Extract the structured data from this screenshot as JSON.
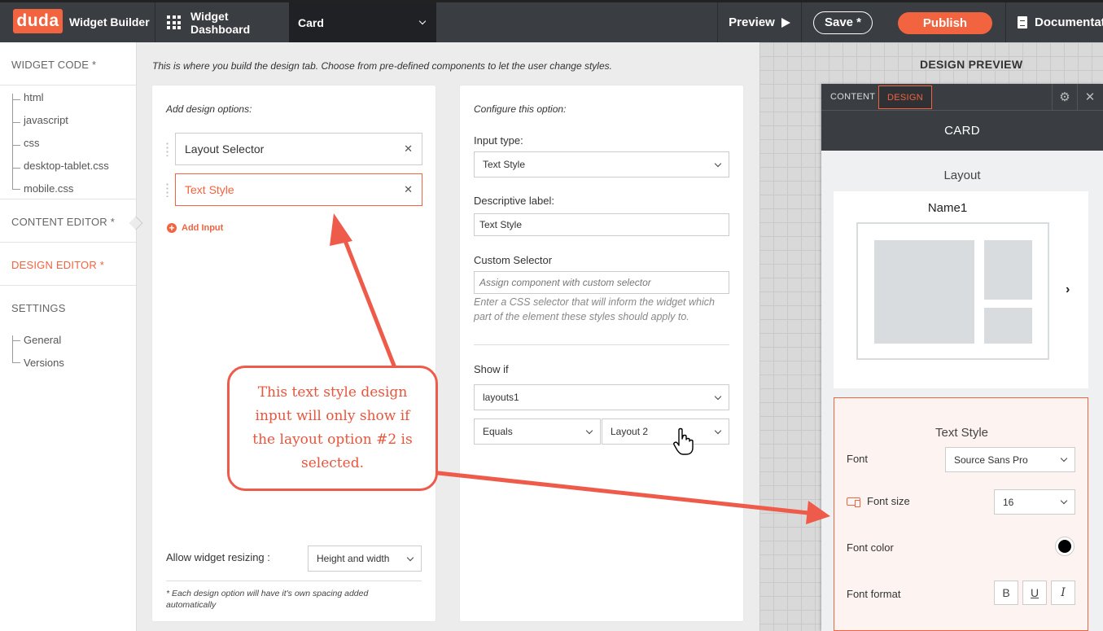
{
  "topbar": {
    "logo": "duda",
    "brand": "Widget Builder",
    "dashboard": "Widget Dashboard",
    "current_widget": "Card",
    "preview": "Preview",
    "save": "Save *",
    "publish": "Publish",
    "docs": "Documentation"
  },
  "sidebar": {
    "widget_code": "WIDGET CODE *",
    "code_files": [
      "html",
      "javascript",
      "css",
      "desktop-tablet.css",
      "mobile.css"
    ],
    "content_editor": "CONTENT EDITOR *",
    "design_editor": "DESIGN EDITOR *",
    "settings": "SETTINGS",
    "settings_items": [
      "General",
      "Versions"
    ]
  },
  "main": {
    "intro": "This is where you build the design tab. Choose from pre-defined components to let the user change styles.",
    "add_panel": {
      "title": "Add design options:",
      "options": [
        "Layout Selector",
        "Text Style"
      ],
      "add_input": "Add Input",
      "resize_label": "Allow widget resizing :",
      "resize_value": "Height and width",
      "footnote": "* Each design option will have it's own spacing added automatically"
    },
    "config_panel": {
      "title": "Configure this option:",
      "input_type_label": "Input type:",
      "input_type_value": "Text Style",
      "desc_label": "Descriptive label:",
      "desc_value": "Text Style",
      "selector_label": "Custom Selector",
      "selector_placeholder": "Assign component with custom selector",
      "selector_help": "Enter a CSS selector that will inform the widget which part of the element these styles should apply to.",
      "show_if_label": "Show if",
      "show_if_field": "layouts1",
      "show_if_operator": "Equals",
      "show_if_value": "Layout 2"
    }
  },
  "callout": "This text style design input will only show if the layout option #2 is selected.",
  "design_preview": {
    "title": "DESIGN PREVIEW",
    "tabs": [
      "CONTENT",
      "DESIGN"
    ],
    "header": "CARD",
    "layout_section": "Layout",
    "layout_name": "Name1",
    "text_style": {
      "title": "Text Style",
      "font_label": "Font",
      "font_value": "Source Sans Pro",
      "size_label": "Font size",
      "size_value": "16",
      "color_label": "Font color",
      "format_label": "Font format",
      "format_buttons": [
        "B",
        "U",
        "I"
      ]
    }
  },
  "colors": {
    "accent": "#f2633f",
    "callout": "#ef5b4b",
    "topbar": "#3a3d41"
  }
}
